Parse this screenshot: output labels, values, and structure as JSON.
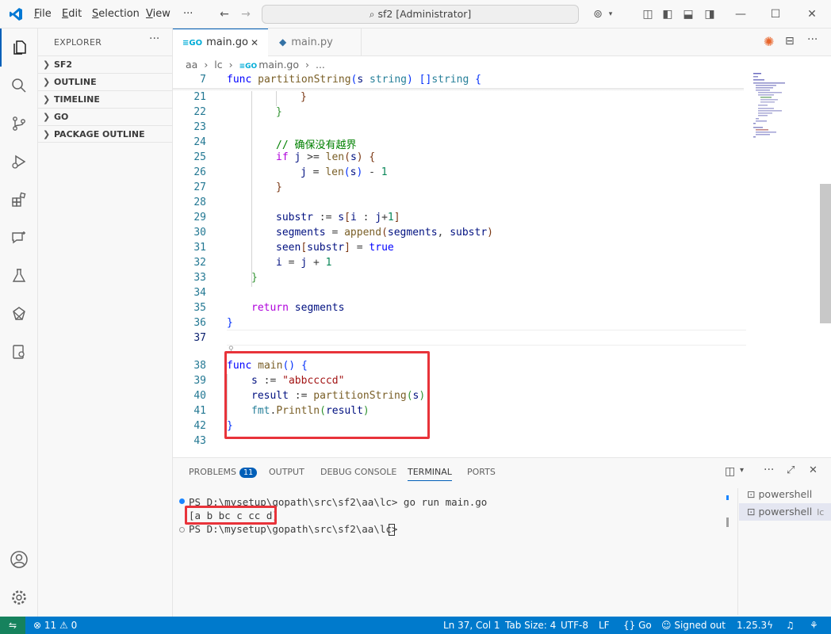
{
  "titlebar": {
    "menus": [
      "File",
      "Edit",
      "Selection",
      "View"
    ],
    "more": "···",
    "search_text": "sf2 [Administrator]"
  },
  "sidebar": {
    "header": "EXPLORER",
    "more": "···",
    "sections": [
      "SF2",
      "OUTLINE",
      "TIMELINE",
      "GO",
      "PACKAGE OUTLINE"
    ]
  },
  "tabs": [
    {
      "label": "main.go",
      "icon": "go-icon",
      "active": true
    },
    {
      "label": "main.py",
      "icon": "python-icon",
      "active": false
    }
  ],
  "breadcrumb": [
    "aa",
    "lc",
    "main.go",
    "..."
  ],
  "editor": {
    "lines": [
      {
        "num": "7",
        "code": "func partitionString(s string) []string {"
      },
      {
        "num": "21",
        "code": "}"
      },
      {
        "num": "22",
        "code": "}"
      },
      {
        "num": "23",
        "code": ""
      },
      {
        "num": "24",
        "code": "// 确保没有越界"
      },
      {
        "num": "25",
        "code": "if j >= len(s) {"
      },
      {
        "num": "26",
        "code": "j = len(s) - 1"
      },
      {
        "num": "27",
        "code": "}"
      },
      {
        "num": "28",
        "code": ""
      },
      {
        "num": "29",
        "code": "substr := s[i : j+1]"
      },
      {
        "num": "30",
        "code": "segments = append(segments, substr)"
      },
      {
        "num": "31",
        "code": "seen[substr] = true"
      },
      {
        "num": "32",
        "code": "i = j + 1"
      },
      {
        "num": "33",
        "code": "}"
      },
      {
        "num": "34",
        "code": ""
      },
      {
        "num": "35",
        "code": "return segments"
      },
      {
        "num": "36",
        "code": "}"
      },
      {
        "num": "37",
        "code": ""
      },
      {
        "num": "38",
        "code": "func main() {"
      },
      {
        "num": "39",
        "code": "s := \"abbccccd\""
      },
      {
        "num": "40",
        "code": "result := partitionString(s)"
      },
      {
        "num": "41",
        "code": "fmt.Println(result)"
      },
      {
        "num": "42",
        "code": "}"
      },
      {
        "num": "43",
        "code": ""
      }
    ]
  },
  "panel": {
    "tabs": [
      "PROBLEMS",
      "OUTPUT",
      "DEBUG CONSOLE",
      "TERMINAL",
      "PORTS"
    ],
    "problems_count": "11",
    "terminal": {
      "line1": "PS D:\\mysetup\\gopath\\src\\sf2\\aa\\lc> go run main.go",
      "line2": "[a b bc c cc d]",
      "line3": "PS D:\\mysetup\\gopath\\src\\sf2\\aa\\lc> "
    },
    "terminal_list": [
      {
        "label": "powershell",
        "suffix": ""
      },
      {
        "label": "powershell",
        "suffix": "lc"
      }
    ]
  },
  "statusbar": {
    "errors": "11",
    "warnings": "0",
    "position": "Ln 37, Col 1",
    "tab_size": "Tab Size: 4",
    "encoding": "UTF-8",
    "eol": "LF",
    "language": "Go",
    "account": "Signed out",
    "version": "1.25.3"
  },
  "colors": {
    "accent": "#005fb8",
    "statusbar": "#007acc",
    "highlight_box": "#e8333a"
  }
}
